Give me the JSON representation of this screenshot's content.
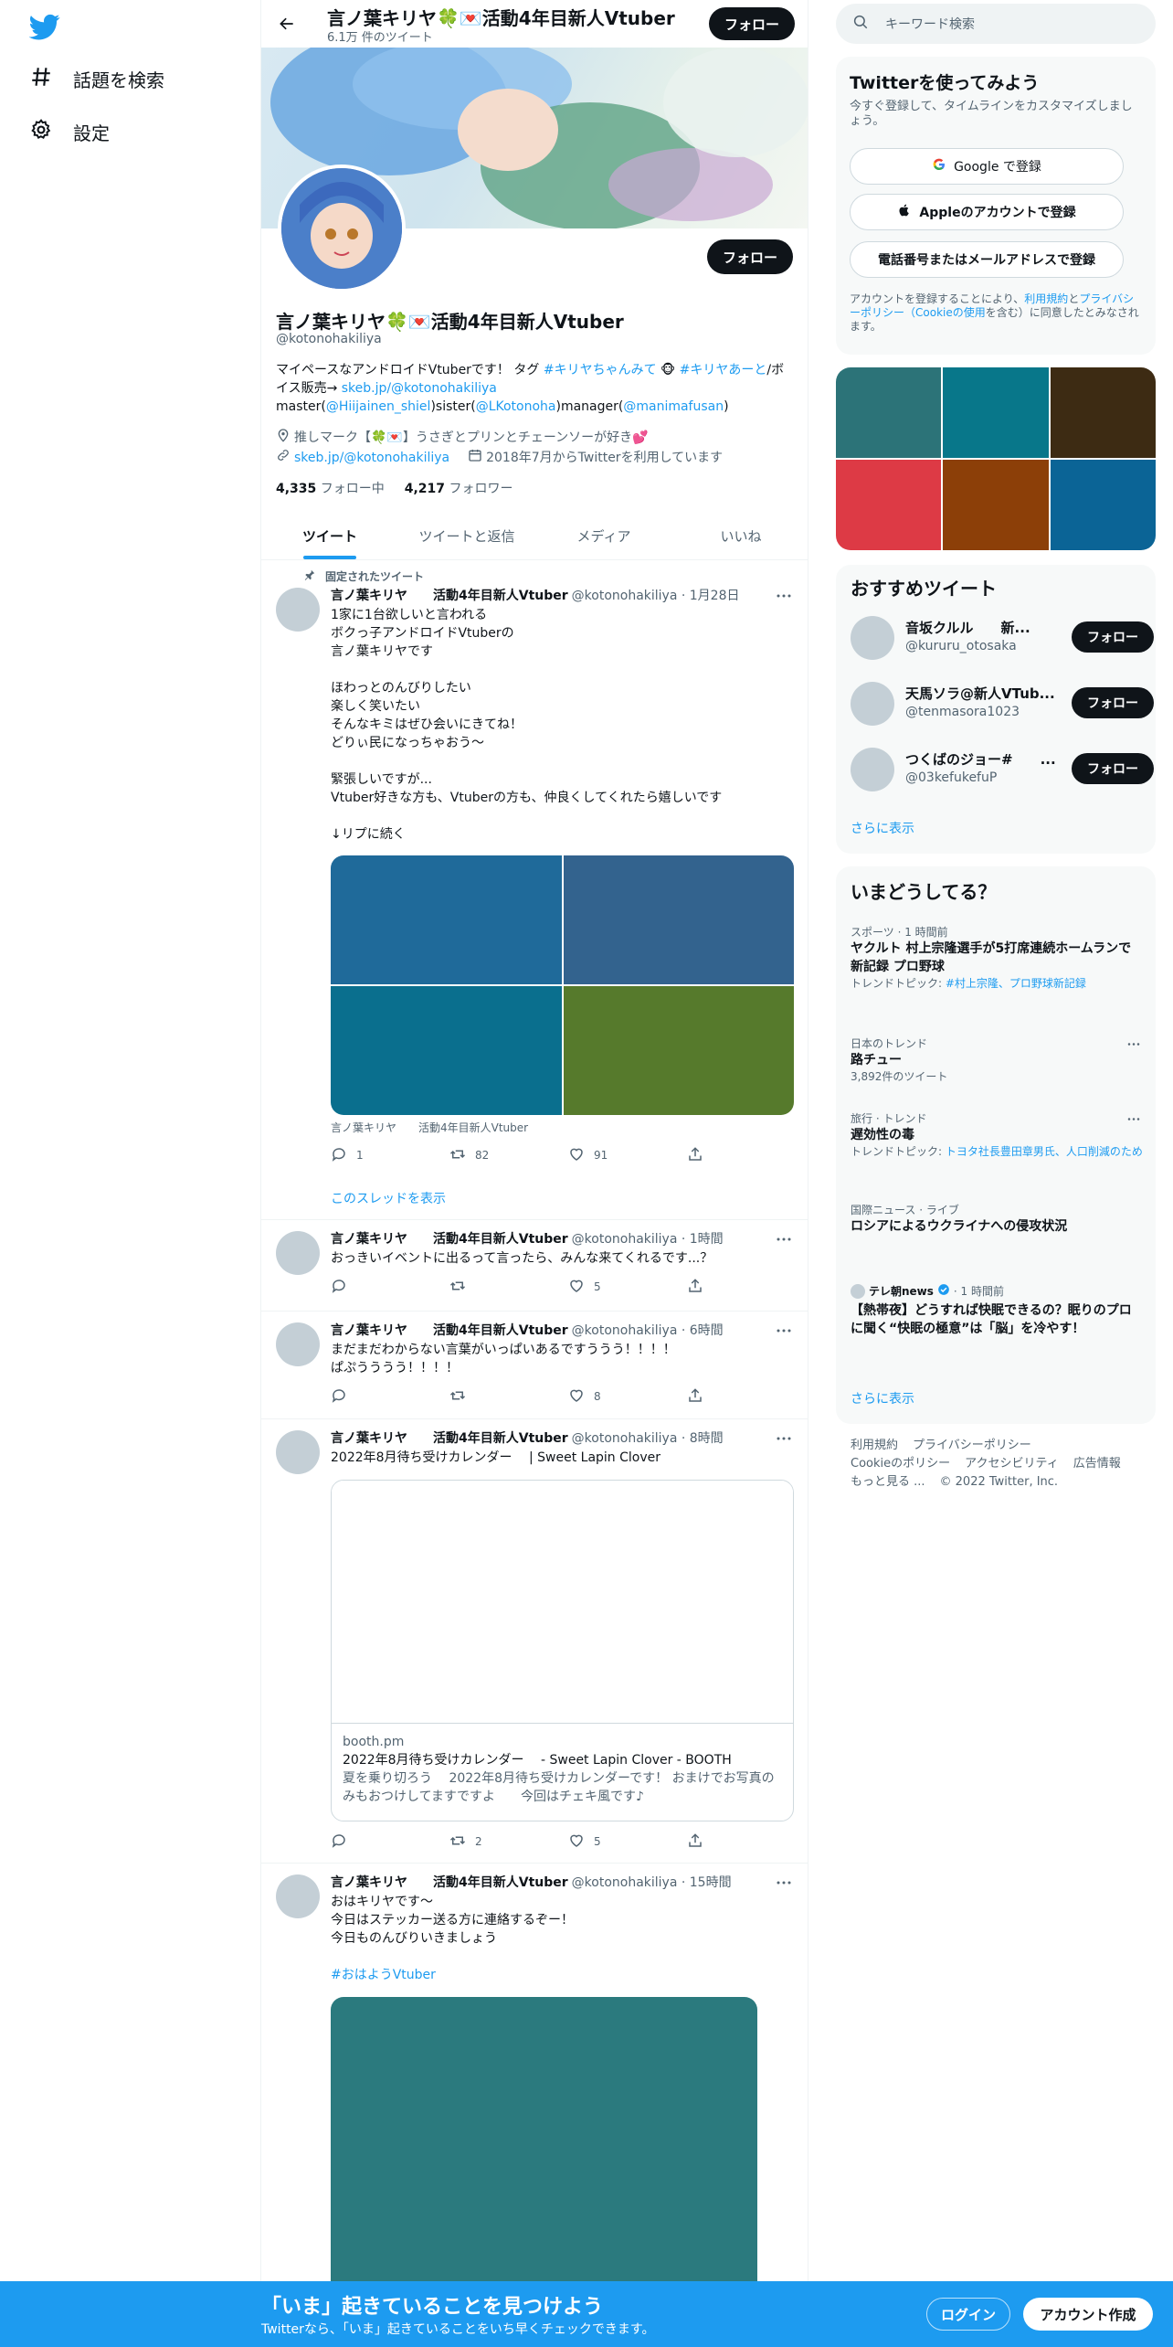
{
  "colors": {
    "accent": "#1d9bf0",
    "text": "#0f1419",
    "muted": "#536471",
    "border": "#eff3f4"
  },
  "nav": {
    "explore": "話題を検索",
    "settings": "設定"
  },
  "header": {
    "title": "言ノ葉キリヤ🍀💌活動4年目新人Vtuber",
    "subtitle": "6.1万 件のツイート",
    "follow": "フォロー"
  },
  "profile": {
    "name": "言ノ葉キリヤ🍀💌活動4年目新人Vtuber",
    "handle": "@kotonohakiliya",
    "follow": "フォロー",
    "bio": {
      "t1": "マイペースなアンドロイドVtuberです！ タグ ",
      "tag1": "#キリヤちゃんみて",
      "t2": " 🐵 ",
      "tag2": "#キリヤあーと",
      "t3": "/ボイス販売→ ",
      "link1": "skeb.jp/@kotonohakiliya",
      "t4": " master(",
      "m1": "@Hiijainen_shiel",
      "t5": ")sister(",
      "m2": "@LKotonoha",
      "t6": ")manager(",
      "m3": "@manimafusan",
      "t7": ")"
    },
    "location": "推しマーク【🍀💌】うさぎとプリンとチェーンソーが好き💕",
    "website": "skeb.jp/@kotonohakiliya",
    "joined": "2018年7月からTwitterを利用しています",
    "following_count": "4,335",
    "following_label": "フォロー中",
    "followers_count": "4,217",
    "followers_label": "フォロワー"
  },
  "tabs": [
    "ツイート",
    "ツイートと返信",
    "メディア",
    "いいね"
  ],
  "tweets": [
    {
      "pinned": "固定されたツイート",
      "name": "言ノ葉キリヤ　　活動4年目新人Vtuber",
      "handle": "@kotonohakiliya · 1月28日",
      "text": "1家に1台欲しいと言われる\nボクっ子アンドロイドVtuberの\n言ノ葉キリヤです\n\nほわっとのんびりしたい\n楽しく笑いたい\nそんなキミはぜひ会いにきてね！\nどりぃ民になっちゃおう～\n\n緊張しいですが...\nVtuber好きな方も、Vtuberの方も、仲良くしてくれたら嬉しいです\n\n↓リプに続く",
      "media_colors": [
        "#1f6a9a",
        "#33638e",
        "#0a6f8e",
        "#567a2c"
      ],
      "media_caption": "言ノ葉キリヤ　　活動4年目新人Vtuber",
      "reply": "1",
      "retweet": "82",
      "like": "91",
      "show_thread": "このスレッドを表示"
    },
    {
      "name": "言ノ葉キリヤ　　活動4年目新人Vtuber",
      "handle": "@kotonohakiliya · 1時間",
      "text": "おっきいイベントに出るって言ったら、みんな来てくれるです...？",
      "reply": "",
      "retweet": "",
      "like": "5"
    },
    {
      "name": "言ノ葉キリヤ　　活動4年目新人Vtuber",
      "handle": "@kotonohakiliya · 6時間",
      "text": "まだまだわからない言葉がいっぱいあるですううう！！！！\nぱぷうううう！！！！",
      "reply": "",
      "retweet": "",
      "like": "8"
    },
    {
      "name": "言ノ葉キリヤ　　活動4年目新人Vtuber",
      "handle": "@kotonohakiliya · 8時間",
      "text": "2022年8月待ち受けカレンダー　 | Sweet Lapin Clover",
      "card_domain": "booth.pm",
      "card_title": "2022年8月待ち受けカレンダー　 - Sweet Lapin Clover - BOOTH",
      "card_desc": "夏を乗り切ろう　 2022年8月待ち受けカレンダーです！ おまけでお写真のみもおつけしてますですよ　　今回はチェキ風です♪",
      "reply": "",
      "retweet": "2",
      "like": "5"
    },
    {
      "name": "言ノ葉キリヤ　　活動4年目新人Vtuber",
      "handle": "@kotonohakiliya · 15時間",
      "text": "おはキリヤです～\n今日はステッカー送る方に連絡するぞー！\n今日ものんびりいきましょう",
      "hashtag": "#おはようVtuber",
      "media_color": "#2b7a7e"
    }
  ],
  "search": {
    "placeholder": "キーワード検索"
  },
  "signup": {
    "title": "Twitterを使ってみよう",
    "subtitle": "今すぐ登録して、タイムラインをカスタマイズしましょう。",
    "google": "Google で登録",
    "apple": "Appleのアカウントで登録",
    "phone": "電話番号またはメールアドレスで登録",
    "legal_1": "アカウントを登録することにより、",
    "legal_terms": "利用規約",
    "legal_2": "と",
    "legal_privacy": "プライバシーポリシー（Cookieの使用",
    "legal_3": "を含む）に同意したとみなされます。"
  },
  "photo_grid_colors": [
    "#2c7378",
    "#08778a",
    "#3d2b13",
    "#dd3a45",
    "#8c3f08",
    "#0b6496"
  ],
  "recommended": {
    "title": "おすすめツイート",
    "users": [
      {
        "name": "音坂クルル　　新...",
        "handle": "@kururu_otosaka",
        "follow": "フォロー"
      },
      {
        "name": "天馬ソラ@新人VTub...",
        "handle": "@tenmasora1023",
        "follow": "フォロー"
      },
      {
        "name": "つくばのジョー#　　...",
        "handle": "@03kefukefuP",
        "follow": "フォロー"
      }
    ],
    "more": "さらに表示"
  },
  "trends": {
    "title": "いまどうしてる？",
    "items": [
      {
        "cat": "スポーツ · 1 時間前",
        "title": "ヤクルト 村上宗隆選手が5打席連続ホームランで新記録 プロ野球",
        "sub_label": "トレンドトピック: ",
        "sub_link": "#村上宗隆、プロ野球新記録"
      },
      {
        "cat": "日本のトレンド",
        "title": "路チュー",
        "sub": "3,892件のツイート"
      },
      {
        "cat": "旅行 · トレンド",
        "title": "遅効性の毒",
        "sub_label": "トレンドトピック: ",
        "sub_link": "トヨタ社長豊田章男氏、人口削減のため"
      },
      {
        "cat": "国際ニュース · ライブ",
        "title": "ロシアによるウクライナへの侵攻状況"
      },
      {
        "source": "テレ朝news",
        "time": " · 1 時間前",
        "title": "【熱帯夜】どうすれば快眠できるの？眠りのプロに聞く“快眠の極意”は「脳」を冷やす！"
      }
    ],
    "more": "さらに表示"
  },
  "footer": {
    "links": [
      "利用規約",
      "プライバシーポリシー",
      "Cookieのポリシー",
      "アクセシビリティ",
      "広告情報",
      "もっと見る ...",
      "© 2022 Twitter, Inc."
    ]
  },
  "bottombar": {
    "title": "「いま」起きていることを見つけよう",
    "subtitle": "Twitterなら、「いま」起きていることをいち早くチェックできます。",
    "login": "ログイン",
    "signup": "アカウント作成"
  }
}
